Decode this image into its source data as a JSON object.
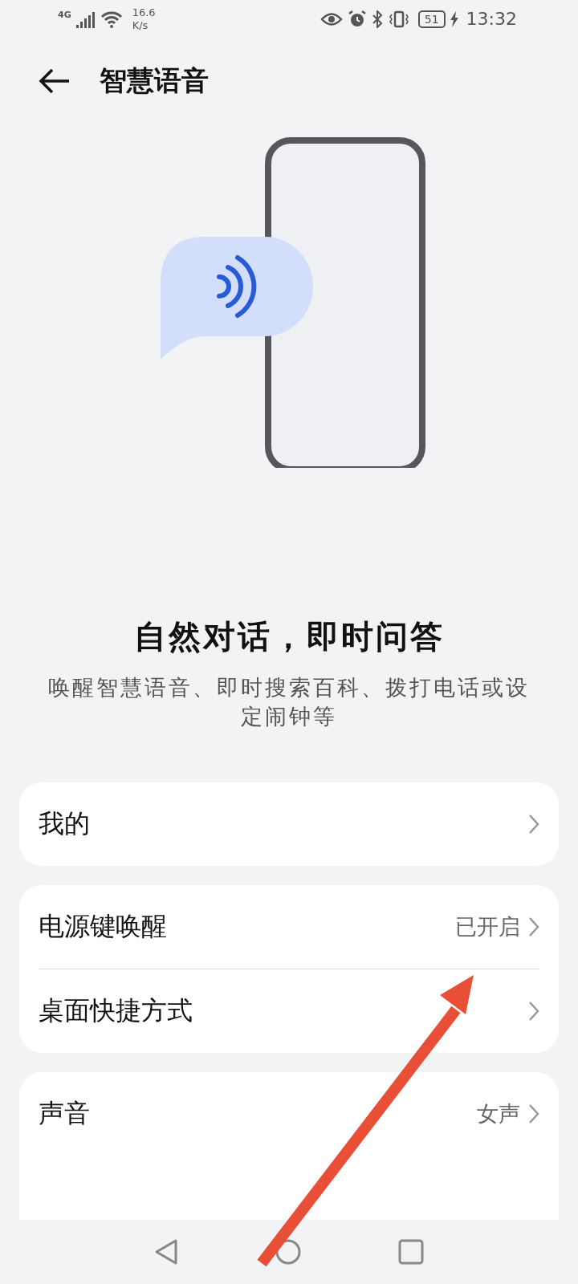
{
  "status_bar": {
    "network": "4G",
    "speed": "16.6",
    "speed_unit": "K/s",
    "battery": "51",
    "time": "13:32"
  },
  "header": {
    "title": "智慧语音"
  },
  "hero": {
    "title": "自然对话，即时问答",
    "subtitle": "唤醒智慧语音、即时搜索百科、拨打电话或设定闹钟等"
  },
  "groups": [
    {
      "items": [
        {
          "label": "我的"
        }
      ]
    },
    {
      "items": [
        {
          "label": "电源键唤醒",
          "value": "已开启"
        },
        {
          "label": "桌面快捷方式"
        }
      ]
    },
    {
      "items": [
        {
          "label": "声音",
          "value": "女声"
        }
      ]
    }
  ],
  "annotation": {
    "kind": "arrow"
  }
}
